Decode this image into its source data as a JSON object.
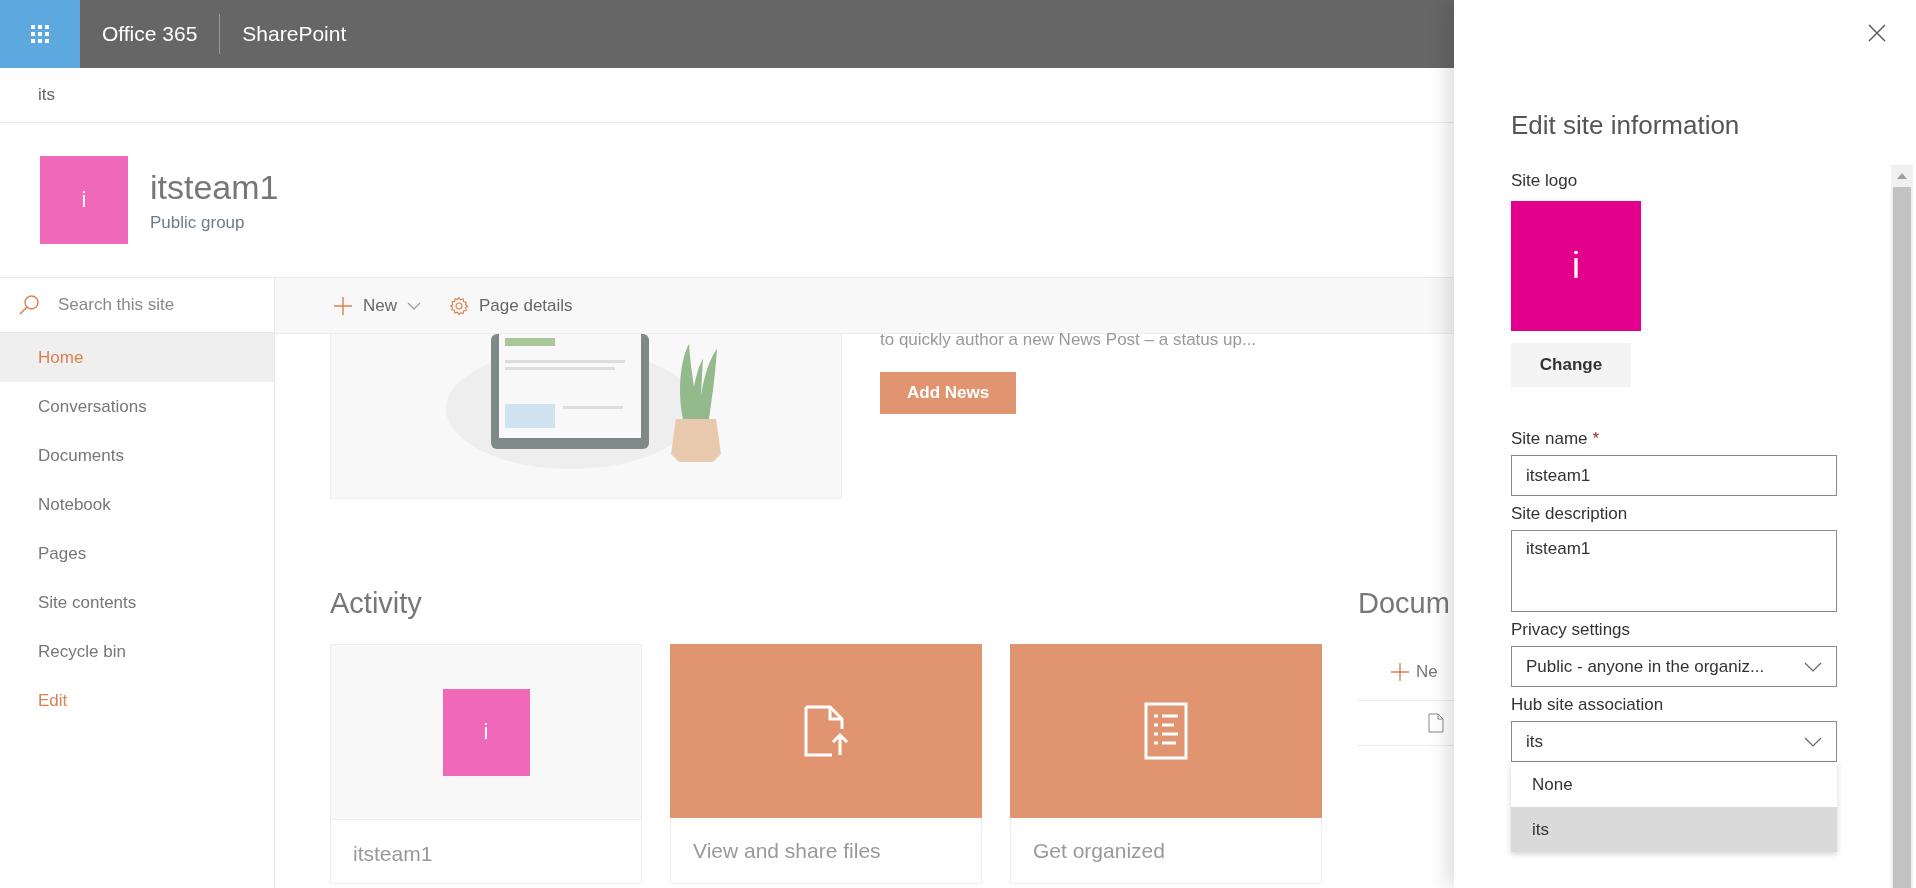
{
  "suite_bar": {
    "brand": "Office 365",
    "app": "SharePoint"
  },
  "hub_nav": {
    "title": "its"
  },
  "site_header": {
    "logo_letter": "i",
    "title": "itsteam1",
    "subtitle": "Public group"
  },
  "search": {
    "placeholder": "Search this site"
  },
  "nav": [
    {
      "label": "Home",
      "kind": "page",
      "selected": true
    },
    {
      "label": "Conversations",
      "kind": "page",
      "selected": false
    },
    {
      "label": "Documents",
      "kind": "page",
      "selected": false
    },
    {
      "label": "Notebook",
      "kind": "page",
      "selected": false
    },
    {
      "label": "Pages",
      "kind": "page",
      "selected": false
    },
    {
      "label": "Site contents",
      "kind": "page",
      "selected": false
    },
    {
      "label": "Recycle bin",
      "kind": "page",
      "selected": false
    },
    {
      "label": "Edit",
      "kind": "action",
      "selected": false
    }
  ],
  "command_bar": [
    {
      "label": "New",
      "kind": "new"
    },
    {
      "label": "Page details",
      "kind": "details"
    }
  ],
  "news": {
    "text": "to quickly author a new News Post – a status up...",
    "button": "Add News"
  },
  "activity": {
    "title": "Activity",
    "cards": [
      {
        "kind": "site",
        "logo_letter": "i",
        "label": "itsteam1"
      },
      {
        "kind": "files",
        "label": "View and share files"
      },
      {
        "kind": "list",
        "label": "Get organized"
      }
    ]
  },
  "documents": {
    "title": "Docum",
    "new": "Ne"
  },
  "panel": {
    "title": "Edit site information",
    "logo_label": "Site logo",
    "logo_letter": "i",
    "change_button": "Change",
    "fields": [
      {
        "kind": "text",
        "label": "Site name",
        "required_mark": "*",
        "value": "itsteam1"
      },
      {
        "kind": "textarea",
        "label": "Site description",
        "value": "itsteam1"
      },
      {
        "kind": "select",
        "label": "Privacy settings",
        "value": "Public - anyone in the organiz..."
      },
      {
        "kind": "select",
        "label": "Hub site association",
        "value": "its",
        "options": [
          {
            "label": "None",
            "selected": false
          },
          {
            "label": "its",
            "selected": true
          }
        ]
      }
    ]
  }
}
